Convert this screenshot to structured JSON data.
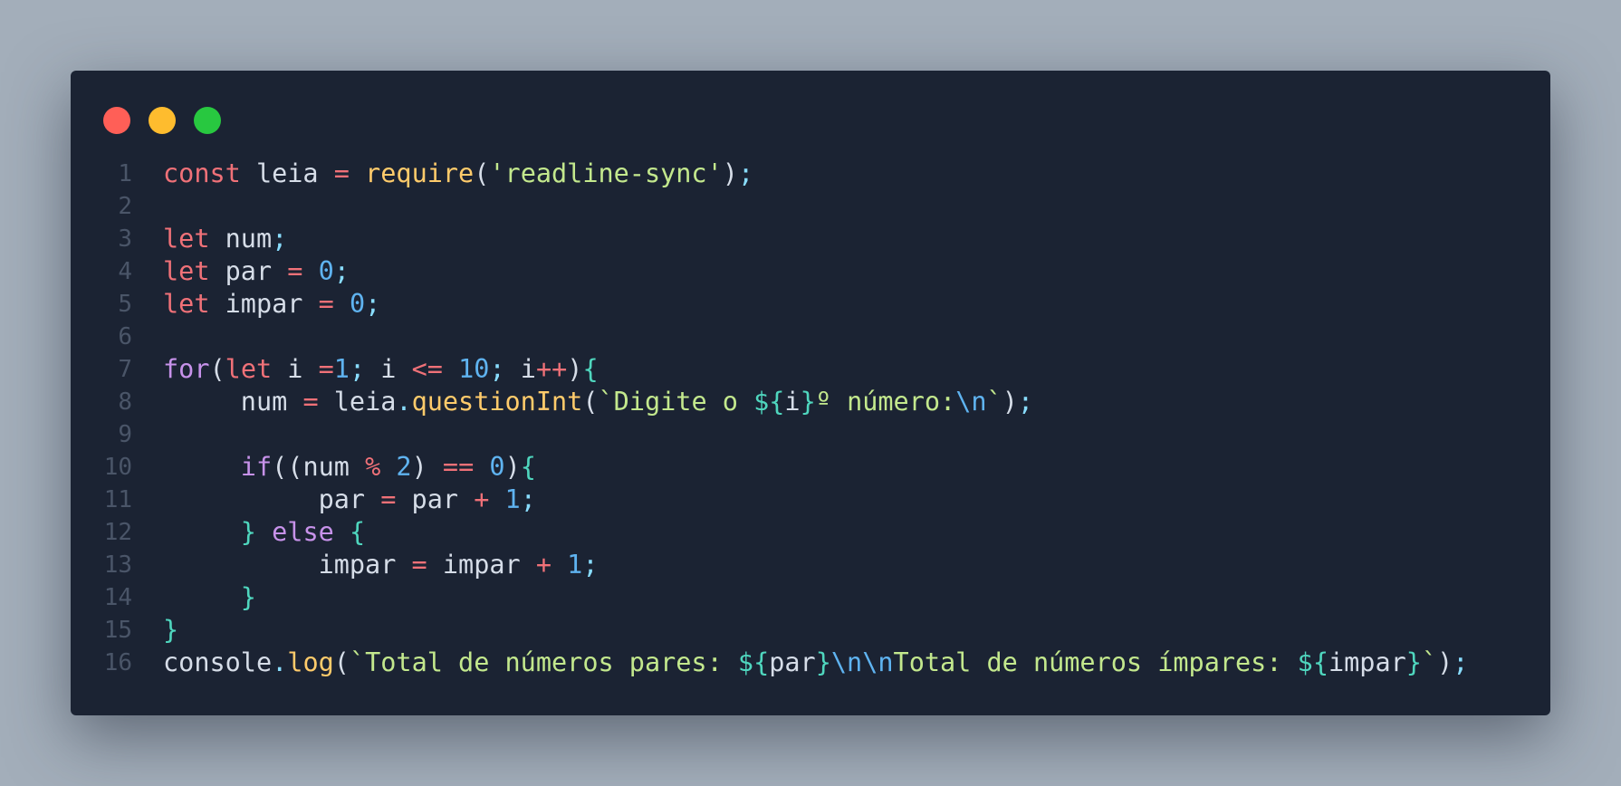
{
  "window": {
    "traffic_lights": [
      {
        "name": "close",
        "color": "#ff5f57"
      },
      {
        "name": "minimize",
        "color": "#febc2e"
      },
      {
        "name": "maximize",
        "color": "#28c840"
      }
    ]
  },
  "editor": {
    "language": "javascript",
    "colors": {
      "background": "#1b2333",
      "keyword": "#f07178",
      "control": "#c792ea",
      "function": "#ffcb6b",
      "string": "#c3e88d",
      "number": "#5fb3f0",
      "operator": "#f07178",
      "punctuation": "#89ddff",
      "template_delimiter": "#4fd6be",
      "identifier": "#d6dde8",
      "line_number": "#4a5568"
    },
    "lines": [
      {
        "number": "1",
        "code": "const leia = require('readline-sync');",
        "tokens": [
          {
            "t": "kw",
            "v": "const"
          },
          {
            "t": "id",
            "v": " leia "
          },
          {
            "t": "op",
            "v": "="
          },
          {
            "t": "id",
            "v": " "
          },
          {
            "t": "fn",
            "v": "require"
          },
          {
            "t": "id",
            "v": "("
          },
          {
            "t": "str",
            "v": "'readline-sync'"
          },
          {
            "t": "id",
            "v": ")"
          },
          {
            "t": "pun",
            "v": ";"
          }
        ]
      },
      {
        "number": "2",
        "code": "",
        "tokens": []
      },
      {
        "number": "3",
        "code": "let num;",
        "tokens": [
          {
            "t": "kw",
            "v": "let"
          },
          {
            "t": "id",
            "v": " num"
          },
          {
            "t": "pun",
            "v": ";"
          }
        ]
      },
      {
        "number": "4",
        "code": "let par = 0;",
        "tokens": [
          {
            "t": "kw",
            "v": "let"
          },
          {
            "t": "id",
            "v": " par "
          },
          {
            "t": "op",
            "v": "="
          },
          {
            "t": "id",
            "v": " "
          },
          {
            "t": "num",
            "v": "0"
          },
          {
            "t": "pun",
            "v": ";"
          }
        ]
      },
      {
        "number": "5",
        "code": "let impar = 0;",
        "tokens": [
          {
            "t": "kw",
            "v": "let"
          },
          {
            "t": "id",
            "v": " impar "
          },
          {
            "t": "op",
            "v": "="
          },
          {
            "t": "id",
            "v": " "
          },
          {
            "t": "num",
            "v": "0"
          },
          {
            "t": "pun",
            "v": ";"
          }
        ]
      },
      {
        "number": "6",
        "code": "",
        "tokens": []
      },
      {
        "number": "7",
        "code": "for(let i =1; i <= 10; i++){",
        "tokens": [
          {
            "t": "ctl",
            "v": "for"
          },
          {
            "t": "id",
            "v": "("
          },
          {
            "t": "kw",
            "v": "let"
          },
          {
            "t": "id",
            "v": " i "
          },
          {
            "t": "op",
            "v": "="
          },
          {
            "t": "num",
            "v": "1"
          },
          {
            "t": "pun",
            "v": ";"
          },
          {
            "t": "id",
            "v": " i "
          },
          {
            "t": "op",
            "v": "<="
          },
          {
            "t": "id",
            "v": " "
          },
          {
            "t": "num",
            "v": "10"
          },
          {
            "t": "pun",
            "v": ";"
          },
          {
            "t": "id",
            "v": " i"
          },
          {
            "t": "op",
            "v": "++"
          },
          {
            "t": "id",
            "v": ")"
          },
          {
            "t": "tpl",
            "v": "{"
          }
        ]
      },
      {
        "number": "8",
        "code": "     num = leia.questionInt(`Digite o ${i}º número:\\n`);",
        "tokens": [
          {
            "t": "id",
            "v": "     num "
          },
          {
            "t": "op",
            "v": "="
          },
          {
            "t": "id",
            "v": " leia"
          },
          {
            "t": "pun",
            "v": "."
          },
          {
            "t": "fn",
            "v": "questionInt"
          },
          {
            "t": "id",
            "v": "("
          },
          {
            "t": "str",
            "v": "`Digite o "
          },
          {
            "t": "tpl",
            "v": "${"
          },
          {
            "t": "id",
            "v": "i"
          },
          {
            "t": "tpl",
            "v": "}"
          },
          {
            "t": "str",
            "v": "º número:"
          },
          {
            "t": "esc",
            "v": "\\n"
          },
          {
            "t": "str",
            "v": "`"
          },
          {
            "t": "id",
            "v": ")"
          },
          {
            "t": "pun",
            "v": ";"
          }
        ]
      },
      {
        "number": "9",
        "code": "",
        "tokens": []
      },
      {
        "number": "10",
        "code": "     if((num % 2) == 0){",
        "tokens": [
          {
            "t": "id",
            "v": "     "
          },
          {
            "t": "ctl",
            "v": "if"
          },
          {
            "t": "id",
            "v": "((num "
          },
          {
            "t": "op",
            "v": "%"
          },
          {
            "t": "id",
            "v": " "
          },
          {
            "t": "num",
            "v": "2"
          },
          {
            "t": "id",
            "v": ") "
          },
          {
            "t": "op",
            "v": "=="
          },
          {
            "t": "id",
            "v": " "
          },
          {
            "t": "num",
            "v": "0"
          },
          {
            "t": "id",
            "v": ")"
          },
          {
            "t": "tpl",
            "v": "{"
          }
        ]
      },
      {
        "number": "11",
        "code": "          par = par + 1;",
        "tokens": [
          {
            "t": "id",
            "v": "          par "
          },
          {
            "t": "op",
            "v": "="
          },
          {
            "t": "id",
            "v": " par "
          },
          {
            "t": "op",
            "v": "+"
          },
          {
            "t": "id",
            "v": " "
          },
          {
            "t": "num",
            "v": "1"
          },
          {
            "t": "pun",
            "v": ";"
          }
        ]
      },
      {
        "number": "12",
        "code": "     } else {",
        "tokens": [
          {
            "t": "id",
            "v": "     "
          },
          {
            "t": "tpl",
            "v": "}"
          },
          {
            "t": "id",
            "v": " "
          },
          {
            "t": "ctl",
            "v": "else"
          },
          {
            "t": "id",
            "v": " "
          },
          {
            "t": "tpl",
            "v": "{"
          }
        ]
      },
      {
        "number": "13",
        "code": "          impar = impar + 1;",
        "tokens": [
          {
            "t": "id",
            "v": "          impar "
          },
          {
            "t": "op",
            "v": "="
          },
          {
            "t": "id",
            "v": " impar "
          },
          {
            "t": "op",
            "v": "+"
          },
          {
            "t": "id",
            "v": " "
          },
          {
            "t": "num",
            "v": "1"
          },
          {
            "t": "pun",
            "v": ";"
          }
        ]
      },
      {
        "number": "14",
        "code": "     }",
        "tokens": [
          {
            "t": "id",
            "v": "     "
          },
          {
            "t": "tpl",
            "v": "}"
          }
        ]
      },
      {
        "number": "15",
        "code": "}",
        "tokens": [
          {
            "t": "tpl",
            "v": "}"
          }
        ]
      },
      {
        "number": "16",
        "code": "console.log(`Total de números pares: ${par}\\n\\nTotal de números ímpares: ${impar}`);",
        "tokens": [
          {
            "t": "id",
            "v": "console"
          },
          {
            "t": "pun",
            "v": "."
          },
          {
            "t": "fn",
            "v": "log"
          },
          {
            "t": "id",
            "v": "("
          },
          {
            "t": "str",
            "v": "`Total de números pares: "
          },
          {
            "t": "tpl",
            "v": "${"
          },
          {
            "t": "id",
            "v": "par"
          },
          {
            "t": "tpl",
            "v": "}"
          },
          {
            "t": "esc",
            "v": "\\n\\n"
          },
          {
            "t": "str",
            "v": "Total de números ímpares: "
          },
          {
            "t": "tpl",
            "v": "${"
          },
          {
            "t": "id",
            "v": "impar"
          },
          {
            "t": "tpl",
            "v": "}"
          },
          {
            "t": "str",
            "v": "`"
          },
          {
            "t": "id",
            "v": ")"
          },
          {
            "t": "pun",
            "v": ";"
          }
        ]
      }
    ]
  }
}
